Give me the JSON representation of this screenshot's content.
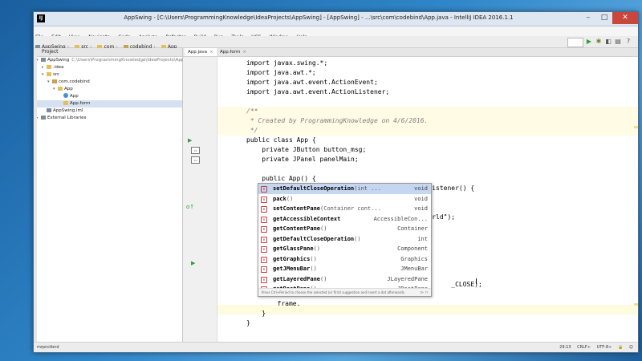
{
  "window": {
    "title": "AppSwing - [C:\\Users\\ProgrammingKnowledge\\IdeaProjects\\AppSwing] - [AppSwing] - ...\\src\\com\\codebind\\App.java - IntelliJ IDEA 2016.1.1",
    "app_icon": "IJ",
    "controls": {
      "minimize": "–",
      "maximize": "□",
      "close": "✕"
    }
  },
  "menu": [
    "File",
    "Edit",
    "View",
    "Navigate",
    "Code",
    "Analyze",
    "Refactor",
    "Build",
    "Run",
    "Tools",
    "VCS",
    "Window",
    "Help"
  ],
  "breadcrumbs": [
    "AppSwing",
    "src",
    "com",
    "codebind",
    "App"
  ],
  "project_panel": {
    "header": "Project",
    "tree": [
      {
        "label": "AppSwing",
        "path": "C:\\Users\\ProgrammingKnowledge\\IdeaProjects\\AppSwing",
        "indent": 0,
        "icon": "project-icon",
        "arrow": "▾"
      },
      {
        "label": ".idea",
        "indent": 1,
        "icon": "folder-icon",
        "arrow": "▸"
      },
      {
        "label": "src",
        "indent": 1,
        "icon": "folder-icon",
        "arrow": "▾"
      },
      {
        "label": "com.codebind",
        "indent": 2,
        "icon": "package-icon",
        "arrow": "▾"
      },
      {
        "label": "App",
        "indent": 3,
        "icon": "folder-icon",
        "arrow": "▾"
      },
      {
        "label": "App",
        "indent": 4,
        "icon": "class-icon",
        "arrow": ""
      },
      {
        "label": "App.form",
        "indent": 4,
        "icon": "form-icon",
        "arrow": ""
      },
      {
        "label": "AppSwing.iml",
        "indent": 1,
        "icon": "iml-icon",
        "arrow": ""
      },
      {
        "label": "External Libraries",
        "indent": 0,
        "icon": "library-icon",
        "arrow": "▸"
      }
    ]
  },
  "editor_tabs": [
    {
      "label": "App.java",
      "active": true
    },
    {
      "label": "App.form",
      "active": false
    }
  ],
  "code_lines": [
    "import javax.swing.*;",
    "import java.awt.*;",
    "import java.awt.event.ActionEvent;",
    "import java.awt.event.ActionListener;",
    "",
    "/**",
    " * Created by ProgrammingKnowledge on 4/6/2016.",
    " */",
    "public class App {",
    "    private JButton button_msg;",
    "    private JPanel panelMain;",
    "",
    "    public App() {",
    "        button_msg.addActionListener(new ActionListener() {",
    "",
    "                                         ) {",
    "                                         ello World\");",
    "        });",
    "    }",
    "",
    "    public",
    "        JFra",
    "        fra",
    "        fra                                          _CLOSE);",
    "        fra",
    "        frame.",
    "    }",
    "}"
  ],
  "completion": {
    "items": [
      {
        "name": "setDefaultCloseOperation",
        "params": "(int ...",
        "type": "void",
        "selected": true
      },
      {
        "name": "pack",
        "params": "()",
        "type": "void"
      },
      {
        "name": "setContentPane",
        "params": "(Container cont...",
        "type": "void"
      },
      {
        "name": "getAccessibleContext",
        "params": "",
        "type": "AccessibleCon..."
      },
      {
        "name": "getContentPane",
        "params": "()",
        "type": "Container"
      },
      {
        "name": "getDefaultCloseOperation",
        "params": "()",
        "type": "int"
      },
      {
        "name": "getGlassPane",
        "params": "()",
        "type": "Component"
      },
      {
        "name": "getGraphics",
        "params": "()",
        "type": "Graphics"
      },
      {
        "name": "getJMenuBar",
        "params": "()",
        "type": "JMenuBar"
      },
      {
        "name": "getLayeredPane",
        "params": "()",
        "type": "JLayeredPane"
      },
      {
        "name": "getRootPane",
        "params": "()",
        "type": "JRootPane"
      }
    ],
    "hint": "Press Ctrl+Period to choose the selected (or first) suggestion and insert a dot afterwards",
    "hint_right": "≫ π"
  },
  "status": {
    "left": "mrpnctbnd",
    "position": "29:13",
    "line_sep": "CRLF÷",
    "encoding": "UTF-8÷"
  }
}
